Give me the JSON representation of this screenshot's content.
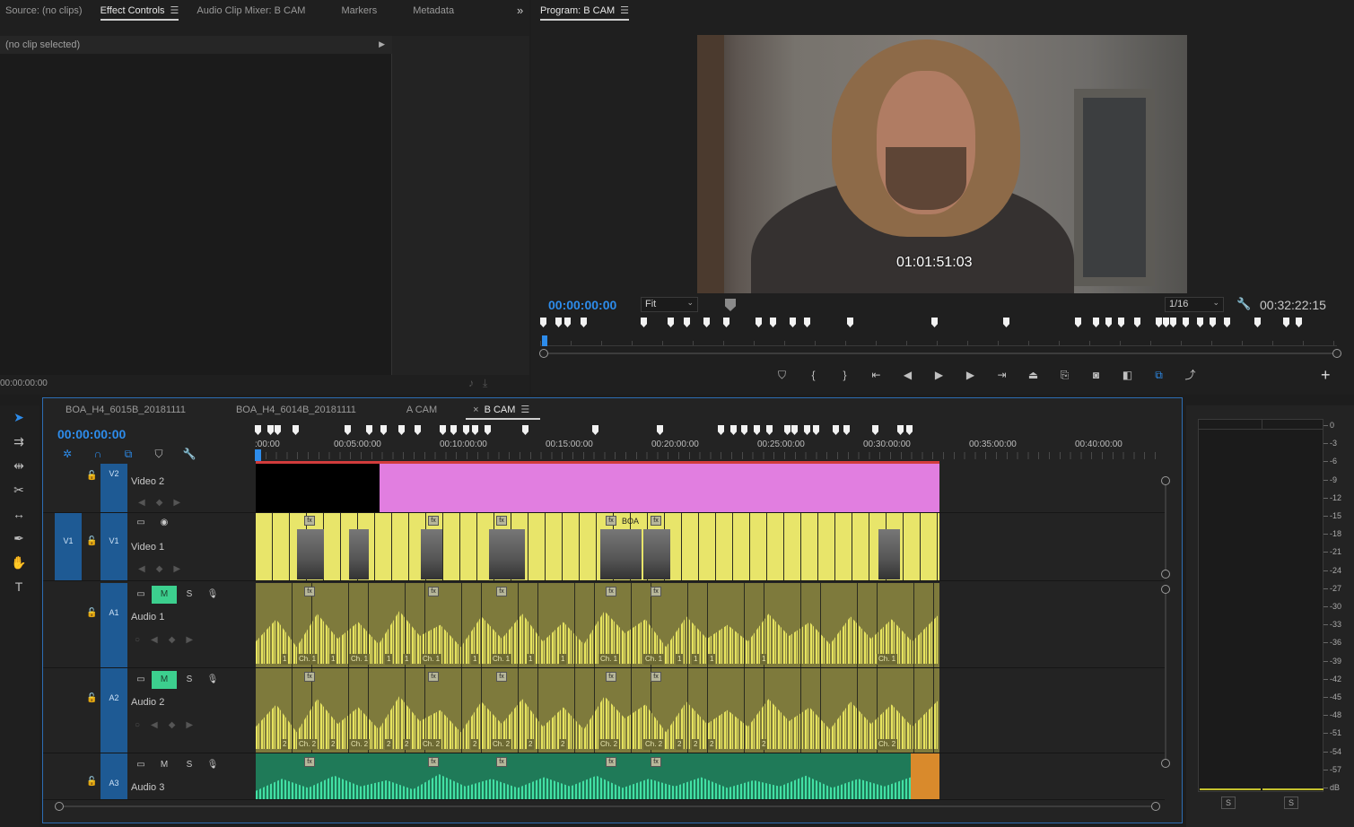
{
  "source_panel": {
    "tabs": [
      {
        "label": "Source: (no clips)"
      },
      {
        "label": "Effect Controls"
      },
      {
        "label": "Audio Clip Mixer: B CAM"
      },
      {
        "label": "Markers"
      },
      {
        "label": "Metadata"
      }
    ],
    "overflow_icon": "double-chevron-right-icon",
    "no_clip_text": "(no clip selected)",
    "timecode": "00:00:00:00"
  },
  "program_panel": {
    "title": "Program: B CAM",
    "overlay_timecode": "01:01:51:03",
    "current_timecode": "00:00:00:00",
    "zoom_select": "Fit",
    "resolution_select": "1/16",
    "duration": "00:32:22:15",
    "controls": [
      {
        "icon": "add-marker-icon",
        "glyph": "⛉"
      },
      {
        "icon": "mark-in-icon",
        "glyph": "{"
      },
      {
        "icon": "mark-out-icon",
        "glyph": "}"
      },
      {
        "icon": "go-to-in-icon",
        "glyph": "⇤"
      },
      {
        "icon": "step-back-icon",
        "glyph": "◀"
      },
      {
        "icon": "play-icon",
        "glyph": "▶"
      },
      {
        "icon": "step-forward-icon",
        "glyph": "▶"
      },
      {
        "icon": "go-to-out-icon",
        "glyph": "⇥"
      },
      {
        "icon": "lift-icon",
        "glyph": "⏏"
      },
      {
        "icon": "extract-icon",
        "glyph": "⎘"
      },
      {
        "icon": "export-frame-icon",
        "glyph": "◙"
      },
      {
        "icon": "comparison-view-icon",
        "glyph": "◧"
      },
      {
        "icon": "multicam-icon",
        "glyph": "⧉"
      },
      {
        "icon": "share-icon",
        "glyph": "⤴"
      }
    ],
    "add_button": "+"
  },
  "tools": [
    {
      "name": "selection-tool-icon",
      "glyph": "➤",
      "active": true
    },
    {
      "name": "track-select-tool-icon",
      "glyph": "⇉"
    },
    {
      "name": "ripple-edit-tool-icon",
      "glyph": "⇹"
    },
    {
      "name": "razor-tool-icon",
      "glyph": "✂"
    },
    {
      "name": "slip-tool-icon",
      "glyph": "↔"
    },
    {
      "name": "pen-tool-icon",
      "glyph": "✒"
    },
    {
      "name": "hand-tool-icon",
      "glyph": "✋"
    },
    {
      "name": "type-tool-icon",
      "glyph": "T"
    }
  ],
  "timeline": {
    "tabs": [
      {
        "label": "BOA_H4_6015B_20181111"
      },
      {
        "label": "BOA_H4_6014B_20181111"
      },
      {
        "label": "A CAM"
      },
      {
        "label": "B CAM",
        "active": true
      }
    ],
    "timecode": "00:00:00:00",
    "ruler_labels": [
      ":00:00",
      "00:05:00:00",
      "00:10:00:00",
      "00:15:00:00",
      "00:20:00:00",
      "00:25:00:00",
      "00:30:00:00",
      "00:35:00:00",
      "00:40:00:00"
    ],
    "tracks": {
      "v2": {
        "target": "V2",
        "name": "Video 2"
      },
      "v1": {
        "source": "V1",
        "target": "V1",
        "name": "Video 1",
        "clip_text": "BOA"
      },
      "a1": {
        "target": "A1",
        "name": "Audio 1",
        "mute": "M",
        "solo": "S",
        "channel_label": "Ch. 1",
        "short_label": "1"
      },
      "a2": {
        "target": "A2",
        "name": "Audio 2",
        "mute": "M",
        "solo": "S",
        "channel_label": "Ch. 2",
        "short_label": "2"
      },
      "a3": {
        "target": "A3",
        "name": "Audio 3",
        "mute": "M",
        "solo": "S"
      }
    },
    "fx_badge": "fx"
  },
  "meter": {
    "db_labels": [
      "0",
      "-3",
      "-6",
      "-9",
      "-12",
      "-15",
      "-18",
      "-21",
      "-24",
      "-27",
      "-30",
      "-33",
      "-36",
      "-39",
      "-42",
      "-45",
      "-48",
      "-51",
      "-54",
      "-57",
      "dB"
    ],
    "solo_buttons": [
      "S",
      "S"
    ],
    "level_color": "#c5c22e"
  },
  "colors": {
    "accent": "#2d8ceb",
    "video_clip": "#e8e56a",
    "v2_clip": "#e17ee0",
    "audio_clip": "#7e7a3c",
    "a3_clip": "#1f7a58",
    "mute_on": "#3ccf8e",
    "track_patch": "#1e5a94"
  }
}
